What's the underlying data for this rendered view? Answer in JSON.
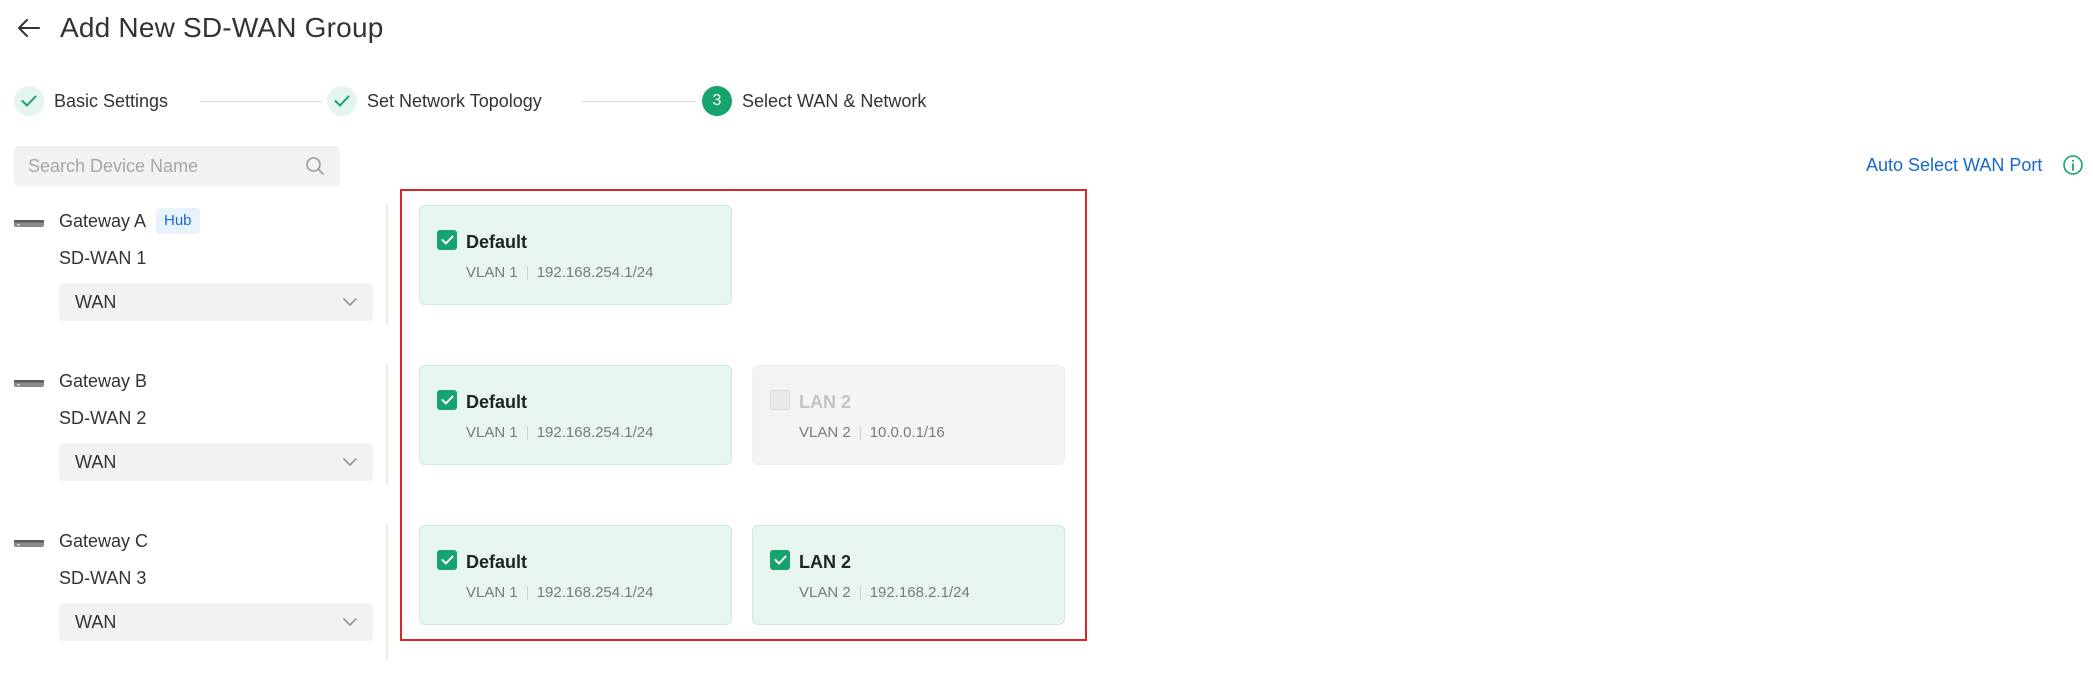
{
  "header": {
    "title": "Add New SD-WAN Group"
  },
  "steps": [
    {
      "label": "Basic Settings",
      "state": "done"
    },
    {
      "label": "Set Network Topology",
      "state": "done"
    },
    {
      "number": "3",
      "label": "Select WAN & Network",
      "state": "active"
    }
  ],
  "search": {
    "placeholder": "Search Device Name",
    "value": ""
  },
  "auto_select": {
    "label": "Auto Select WAN Port"
  },
  "gateways": [
    {
      "name": "Gateway A",
      "badge": "Hub",
      "sdwan": "SD-WAN 1",
      "wan": "WAN",
      "networks": [
        {
          "name": "Default",
          "vlan": "VLAN 1",
          "subnet": "192.168.254.1/24",
          "checked": true,
          "disabled": false
        }
      ]
    },
    {
      "name": "Gateway B",
      "sdwan": "SD-WAN 2",
      "wan": "WAN",
      "networks": [
        {
          "name": "Default",
          "vlan": "VLAN 1",
          "subnet": "192.168.254.1/24",
          "checked": true,
          "disabled": false
        },
        {
          "name": "LAN 2",
          "vlan": "VLAN 2",
          "subnet": "10.0.0.1/16",
          "checked": false,
          "disabled": true
        }
      ]
    },
    {
      "name": "Gateway C",
      "sdwan": "SD-WAN 3",
      "wan": "WAN",
      "networks": [
        {
          "name": "Default",
          "vlan": "VLAN 1",
          "subnet": "192.168.254.1/24",
          "checked": true,
          "disabled": false
        },
        {
          "name": "LAN 2",
          "vlan": "VLAN 2",
          "subnet": "192.168.2.1/24",
          "checked": true,
          "disabled": false
        }
      ]
    }
  ],
  "colors": {
    "accent": "#16a36d",
    "link": "#1767cc",
    "highlight": "#d9262c",
    "card_bg": "#e6f5ee"
  },
  "icons": [
    "back-arrow-icon",
    "check-icon",
    "search-icon",
    "info-icon",
    "gateway-device-icon",
    "chevron-down-icon"
  ]
}
